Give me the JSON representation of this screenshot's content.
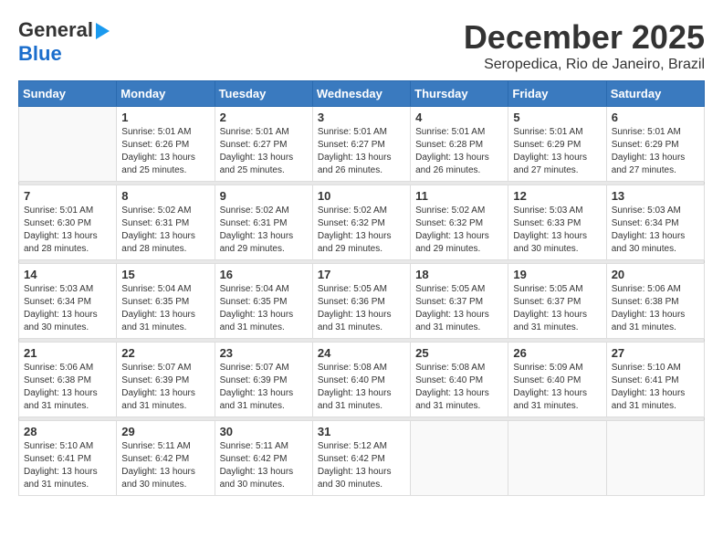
{
  "logo": {
    "line1": "General",
    "line2": "Blue"
  },
  "title": "December 2025",
  "subtitle": "Seropedica, Rio de Janeiro, Brazil",
  "days_of_week": [
    "Sunday",
    "Monday",
    "Tuesday",
    "Wednesday",
    "Thursday",
    "Friday",
    "Saturday"
  ],
  "weeks": [
    [
      {
        "day": "",
        "sunrise": "",
        "sunset": "",
        "daylight": ""
      },
      {
        "day": "1",
        "sunrise": "Sunrise: 5:01 AM",
        "sunset": "Sunset: 6:26 PM",
        "daylight": "Daylight: 13 hours and 25 minutes."
      },
      {
        "day": "2",
        "sunrise": "Sunrise: 5:01 AM",
        "sunset": "Sunset: 6:27 PM",
        "daylight": "Daylight: 13 hours and 25 minutes."
      },
      {
        "day": "3",
        "sunrise": "Sunrise: 5:01 AM",
        "sunset": "Sunset: 6:27 PM",
        "daylight": "Daylight: 13 hours and 26 minutes."
      },
      {
        "day": "4",
        "sunrise": "Sunrise: 5:01 AM",
        "sunset": "Sunset: 6:28 PM",
        "daylight": "Daylight: 13 hours and 26 minutes."
      },
      {
        "day": "5",
        "sunrise": "Sunrise: 5:01 AM",
        "sunset": "Sunset: 6:29 PM",
        "daylight": "Daylight: 13 hours and 27 minutes."
      },
      {
        "day": "6",
        "sunrise": "Sunrise: 5:01 AM",
        "sunset": "Sunset: 6:29 PM",
        "daylight": "Daylight: 13 hours and 27 minutes."
      }
    ],
    [
      {
        "day": "7",
        "sunrise": "Sunrise: 5:01 AM",
        "sunset": "Sunset: 6:30 PM",
        "daylight": "Daylight: 13 hours and 28 minutes."
      },
      {
        "day": "8",
        "sunrise": "Sunrise: 5:02 AM",
        "sunset": "Sunset: 6:31 PM",
        "daylight": "Daylight: 13 hours and 28 minutes."
      },
      {
        "day": "9",
        "sunrise": "Sunrise: 5:02 AM",
        "sunset": "Sunset: 6:31 PM",
        "daylight": "Daylight: 13 hours and 29 minutes."
      },
      {
        "day": "10",
        "sunrise": "Sunrise: 5:02 AM",
        "sunset": "Sunset: 6:32 PM",
        "daylight": "Daylight: 13 hours and 29 minutes."
      },
      {
        "day": "11",
        "sunrise": "Sunrise: 5:02 AM",
        "sunset": "Sunset: 6:32 PM",
        "daylight": "Daylight: 13 hours and 29 minutes."
      },
      {
        "day": "12",
        "sunrise": "Sunrise: 5:03 AM",
        "sunset": "Sunset: 6:33 PM",
        "daylight": "Daylight: 13 hours and 30 minutes."
      },
      {
        "day": "13",
        "sunrise": "Sunrise: 5:03 AM",
        "sunset": "Sunset: 6:34 PM",
        "daylight": "Daylight: 13 hours and 30 minutes."
      }
    ],
    [
      {
        "day": "14",
        "sunrise": "Sunrise: 5:03 AM",
        "sunset": "Sunset: 6:34 PM",
        "daylight": "Daylight: 13 hours and 30 minutes."
      },
      {
        "day": "15",
        "sunrise": "Sunrise: 5:04 AM",
        "sunset": "Sunset: 6:35 PM",
        "daylight": "Daylight: 13 hours and 31 minutes."
      },
      {
        "day": "16",
        "sunrise": "Sunrise: 5:04 AM",
        "sunset": "Sunset: 6:35 PM",
        "daylight": "Daylight: 13 hours and 31 minutes."
      },
      {
        "day": "17",
        "sunrise": "Sunrise: 5:05 AM",
        "sunset": "Sunset: 6:36 PM",
        "daylight": "Daylight: 13 hours and 31 minutes."
      },
      {
        "day": "18",
        "sunrise": "Sunrise: 5:05 AM",
        "sunset": "Sunset: 6:37 PM",
        "daylight": "Daylight: 13 hours and 31 minutes."
      },
      {
        "day": "19",
        "sunrise": "Sunrise: 5:05 AM",
        "sunset": "Sunset: 6:37 PM",
        "daylight": "Daylight: 13 hours and 31 minutes."
      },
      {
        "day": "20",
        "sunrise": "Sunrise: 5:06 AM",
        "sunset": "Sunset: 6:38 PM",
        "daylight": "Daylight: 13 hours and 31 minutes."
      }
    ],
    [
      {
        "day": "21",
        "sunrise": "Sunrise: 5:06 AM",
        "sunset": "Sunset: 6:38 PM",
        "daylight": "Daylight: 13 hours and 31 minutes."
      },
      {
        "day": "22",
        "sunrise": "Sunrise: 5:07 AM",
        "sunset": "Sunset: 6:39 PM",
        "daylight": "Daylight: 13 hours and 31 minutes."
      },
      {
        "day": "23",
        "sunrise": "Sunrise: 5:07 AM",
        "sunset": "Sunset: 6:39 PM",
        "daylight": "Daylight: 13 hours and 31 minutes."
      },
      {
        "day": "24",
        "sunrise": "Sunrise: 5:08 AM",
        "sunset": "Sunset: 6:40 PM",
        "daylight": "Daylight: 13 hours and 31 minutes."
      },
      {
        "day": "25",
        "sunrise": "Sunrise: 5:08 AM",
        "sunset": "Sunset: 6:40 PM",
        "daylight": "Daylight: 13 hours and 31 minutes."
      },
      {
        "day": "26",
        "sunrise": "Sunrise: 5:09 AM",
        "sunset": "Sunset: 6:40 PM",
        "daylight": "Daylight: 13 hours and 31 minutes."
      },
      {
        "day": "27",
        "sunrise": "Sunrise: 5:10 AM",
        "sunset": "Sunset: 6:41 PM",
        "daylight": "Daylight: 13 hours and 31 minutes."
      }
    ],
    [
      {
        "day": "28",
        "sunrise": "Sunrise: 5:10 AM",
        "sunset": "Sunset: 6:41 PM",
        "daylight": "Daylight: 13 hours and 31 minutes."
      },
      {
        "day": "29",
        "sunrise": "Sunrise: 5:11 AM",
        "sunset": "Sunset: 6:42 PM",
        "daylight": "Daylight: 13 hours and 30 minutes."
      },
      {
        "day": "30",
        "sunrise": "Sunrise: 5:11 AM",
        "sunset": "Sunset: 6:42 PM",
        "daylight": "Daylight: 13 hours and 30 minutes."
      },
      {
        "day": "31",
        "sunrise": "Sunrise: 5:12 AM",
        "sunset": "Sunset: 6:42 PM",
        "daylight": "Daylight: 13 hours and 30 minutes."
      },
      {
        "day": "",
        "sunrise": "",
        "sunset": "",
        "daylight": ""
      },
      {
        "day": "",
        "sunrise": "",
        "sunset": "",
        "daylight": ""
      },
      {
        "day": "",
        "sunrise": "",
        "sunset": "",
        "daylight": ""
      }
    ]
  ]
}
